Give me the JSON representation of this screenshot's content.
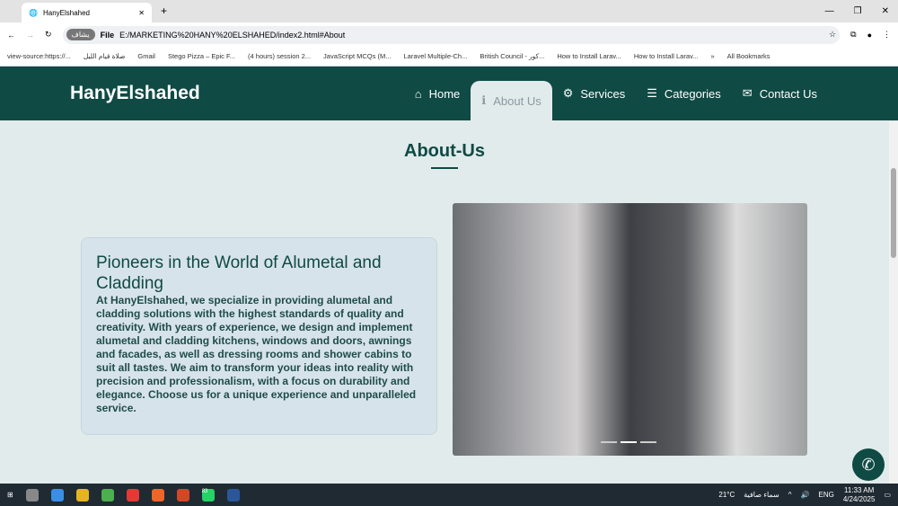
{
  "browser": {
    "tab_title": "HanyElshahed",
    "url_scheme": "File",
    "url": "E:/MARKETING%20HANY%20ELSHAHED/index2.html#About",
    "profile_pill": "يشاف",
    "bookmarks": [
      "view-source:https://...",
      "صلاة قيام الليل",
      "Gmail",
      "Stego Pizza – Epic F...",
      "(4 hours) session 2...",
      "JavaScript MCQs (M...",
      "Laravel Multiple-Ch...",
      "British Council - كور...",
      "How to Install Larav...",
      "How to Install Larav..."
    ],
    "all_bookmarks": "All Bookmarks"
  },
  "nav": {
    "logo": "HanyElshahed",
    "items": [
      {
        "icon": "⌂",
        "label": "Home"
      },
      {
        "icon": "ℹ",
        "label": "About Us"
      },
      {
        "icon": "⚙",
        "label": "Services"
      },
      {
        "icon": "☰",
        "label": "Categories"
      },
      {
        "icon": "✉",
        "label": "Contact Us"
      }
    ]
  },
  "section": {
    "title": "About-Us",
    "card_title": "Pioneers in the World of Alumetal and Cladding",
    "card_text": "At HanyElshahed, we specialize in providing alumetal and cladding solutions with the highest standards of quality and creativity. With years of experience, we design and implement alumetal and cladding kitchens, windows and doors, awnings and facades, as well as dressing rooms and shower cabins to suit all tastes. We aim to transform your ideas into reality with precision and professionalism, with a focus on durability and elegance. Choose us for a unique experience and unparalleled service."
  },
  "taskbar": {
    "weather": "21°C",
    "weather_text": "سماء صافية",
    "lang": "ENG",
    "time": "11:33 AM",
    "date": "4/24/2025",
    "badge": "83"
  }
}
